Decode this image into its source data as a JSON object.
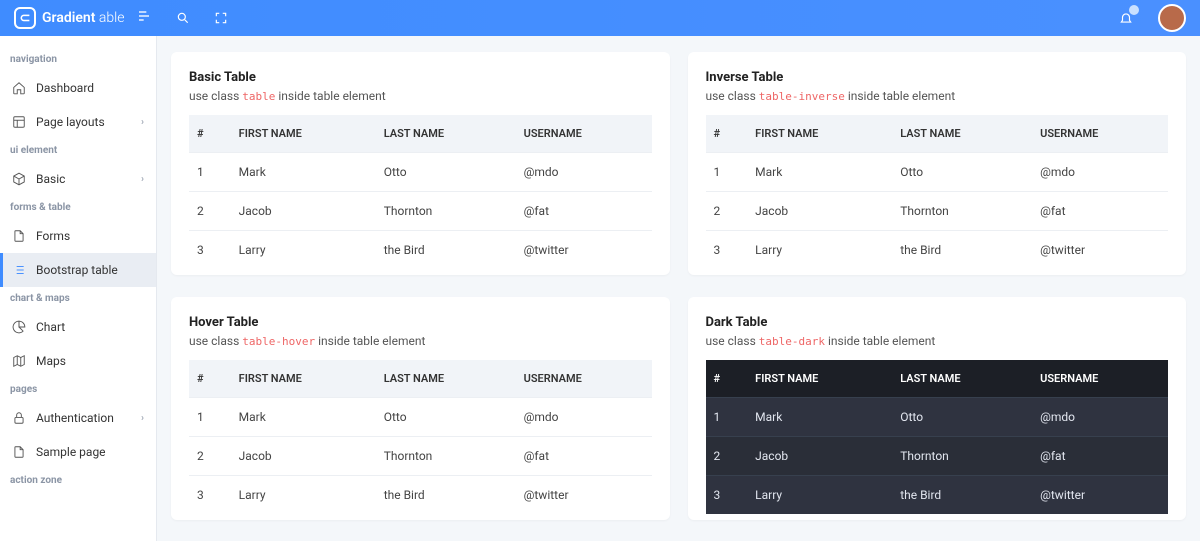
{
  "brand": {
    "part1": "Gradient",
    "part2": " able"
  },
  "nav": {
    "groups": [
      {
        "title": "navigation",
        "items": [
          {
            "key": "dashboard",
            "label": "Dashboard",
            "icon": "home",
            "chev": false
          },
          {
            "key": "page-layouts",
            "label": "Page layouts",
            "icon": "layout",
            "chev": true
          }
        ]
      },
      {
        "title": "ui element",
        "items": [
          {
            "key": "basic",
            "label": "Basic",
            "icon": "box",
            "chev": true
          }
        ]
      },
      {
        "title": "forms & table",
        "items": [
          {
            "key": "forms",
            "label": "Forms",
            "icon": "file",
            "chev": false
          },
          {
            "key": "bootstrap-table",
            "label": "Bootstrap table",
            "icon": "list",
            "chev": false,
            "active": true
          }
        ]
      },
      {
        "title": "chart & maps",
        "items": [
          {
            "key": "chart",
            "label": "Chart",
            "icon": "pie",
            "chev": false
          },
          {
            "key": "maps",
            "label": "Maps",
            "icon": "map",
            "chev": false
          }
        ]
      },
      {
        "title": "pages",
        "items": [
          {
            "key": "authentication",
            "label": "Authentication",
            "icon": "lock",
            "chev": true
          },
          {
            "key": "sample-page",
            "label": "Sample page",
            "icon": "file",
            "chev": false
          }
        ]
      },
      {
        "title": "action zone",
        "items": []
      }
    ]
  },
  "tableHeaders": {
    "num": "#",
    "first": "FIRST NAME",
    "last": "LAST NAME",
    "user": "USERNAME"
  },
  "tableRows": [
    {
      "n": "1",
      "first": "Mark",
      "last": "Otto",
      "user": "@mdo"
    },
    {
      "n": "2",
      "first": "Jacob",
      "last": "Thornton",
      "user": "@fat"
    },
    {
      "n": "3",
      "first": "Larry",
      "last": "the Bird",
      "user": "@twitter"
    }
  ],
  "cards": [
    {
      "key": "basic",
      "title": "Basic Table",
      "pre": "use class ",
      "code": "table",
      "post": " inside table element",
      "dark": false
    },
    {
      "key": "inverse",
      "title": "Inverse Table",
      "pre": "use class ",
      "code": "table-inverse",
      "post": " inside table element",
      "dark": false
    },
    {
      "key": "hover",
      "title": "Hover Table",
      "pre": "use class ",
      "code": "table-hover",
      "post": " inside table element",
      "dark": false
    },
    {
      "key": "dark",
      "title": "Dark Table",
      "pre": "use class ",
      "code": "table-dark",
      "post": " inside table element",
      "dark": true
    }
  ]
}
